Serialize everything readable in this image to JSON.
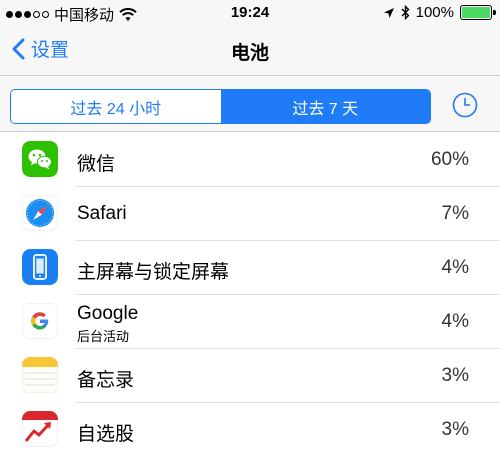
{
  "status_bar": {
    "carrier": "中国移动",
    "time": "19:24",
    "battery_percent": "100%",
    "signal_filled": 3,
    "signal_total": 5
  },
  "nav": {
    "back_label": "设置",
    "title": "电池"
  },
  "segment": {
    "options": [
      "过去 24 小时",
      "过去 7 天"
    ],
    "selected_index": 1
  },
  "colors": {
    "accent": "#1f7bf6",
    "battery": "#4cd964"
  },
  "apps": [
    {
      "name": "微信",
      "sub": "",
      "percent": "60%",
      "icon": "wechat-icon"
    },
    {
      "name": "Safari",
      "sub": "",
      "percent": "7%",
      "icon": "safari-icon"
    },
    {
      "name": "主屏幕与锁定屏幕",
      "sub": "",
      "percent": "4%",
      "icon": "home-lock-screen-icon"
    },
    {
      "name": "Google",
      "sub": "后台活动",
      "percent": "4%",
      "icon": "google-icon"
    },
    {
      "name": "备忘录",
      "sub": "",
      "percent": "3%",
      "icon": "notes-icon"
    },
    {
      "name": "自选股",
      "sub": "",
      "percent": "3%",
      "icon": "stocks-icon"
    }
  ]
}
